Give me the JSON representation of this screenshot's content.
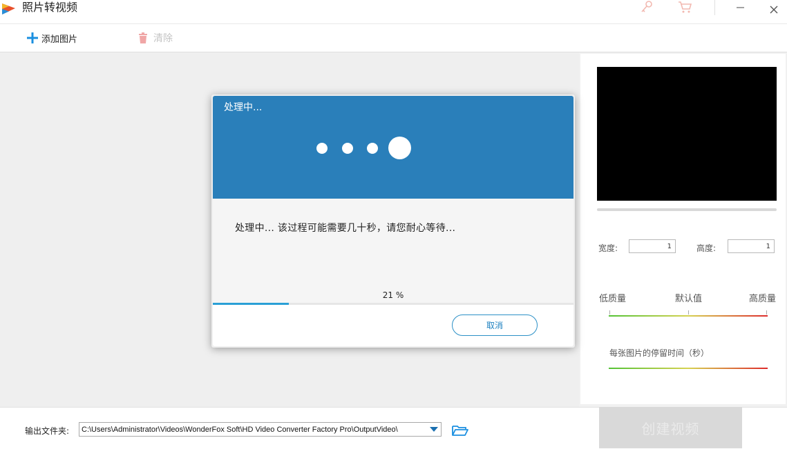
{
  "app": {
    "title": "照片转视频"
  },
  "titlebar": {
    "icons": [
      "app-logo-icon",
      "key-icon",
      "cart-icon",
      "minimize-icon",
      "close-icon"
    ]
  },
  "toolbar": {
    "add_label": "添加图片",
    "clear_label": "清除"
  },
  "settings": {
    "width_label": "宽度:",
    "width_value": "1",
    "height_label": "高度:",
    "height_value": "1",
    "quality_low": "低质量",
    "quality_default": "默认值",
    "quality_high": "高质量",
    "duration_label": "每张图片的停留时间（秒）"
  },
  "output": {
    "label": "输出文件夹:",
    "path": "C:\\Users\\Administrator\\Videos\\WonderFox Soft\\HD Video Converter Factory Pro\\OutputVideo\\"
  },
  "create_button": "创建视频",
  "dialog": {
    "title": "处理中...",
    "message": "处理中... 该过程可能需要几十秒，请您耐心等待...",
    "progress_text": "21 %",
    "progress_fraction": 0.21,
    "cancel_label": "取消"
  },
  "colors": {
    "accent": "#2a7fba",
    "progress": "#2a9fd6",
    "add_icon": "#1a8fe0",
    "clear_icon": "#f0a6a6"
  }
}
